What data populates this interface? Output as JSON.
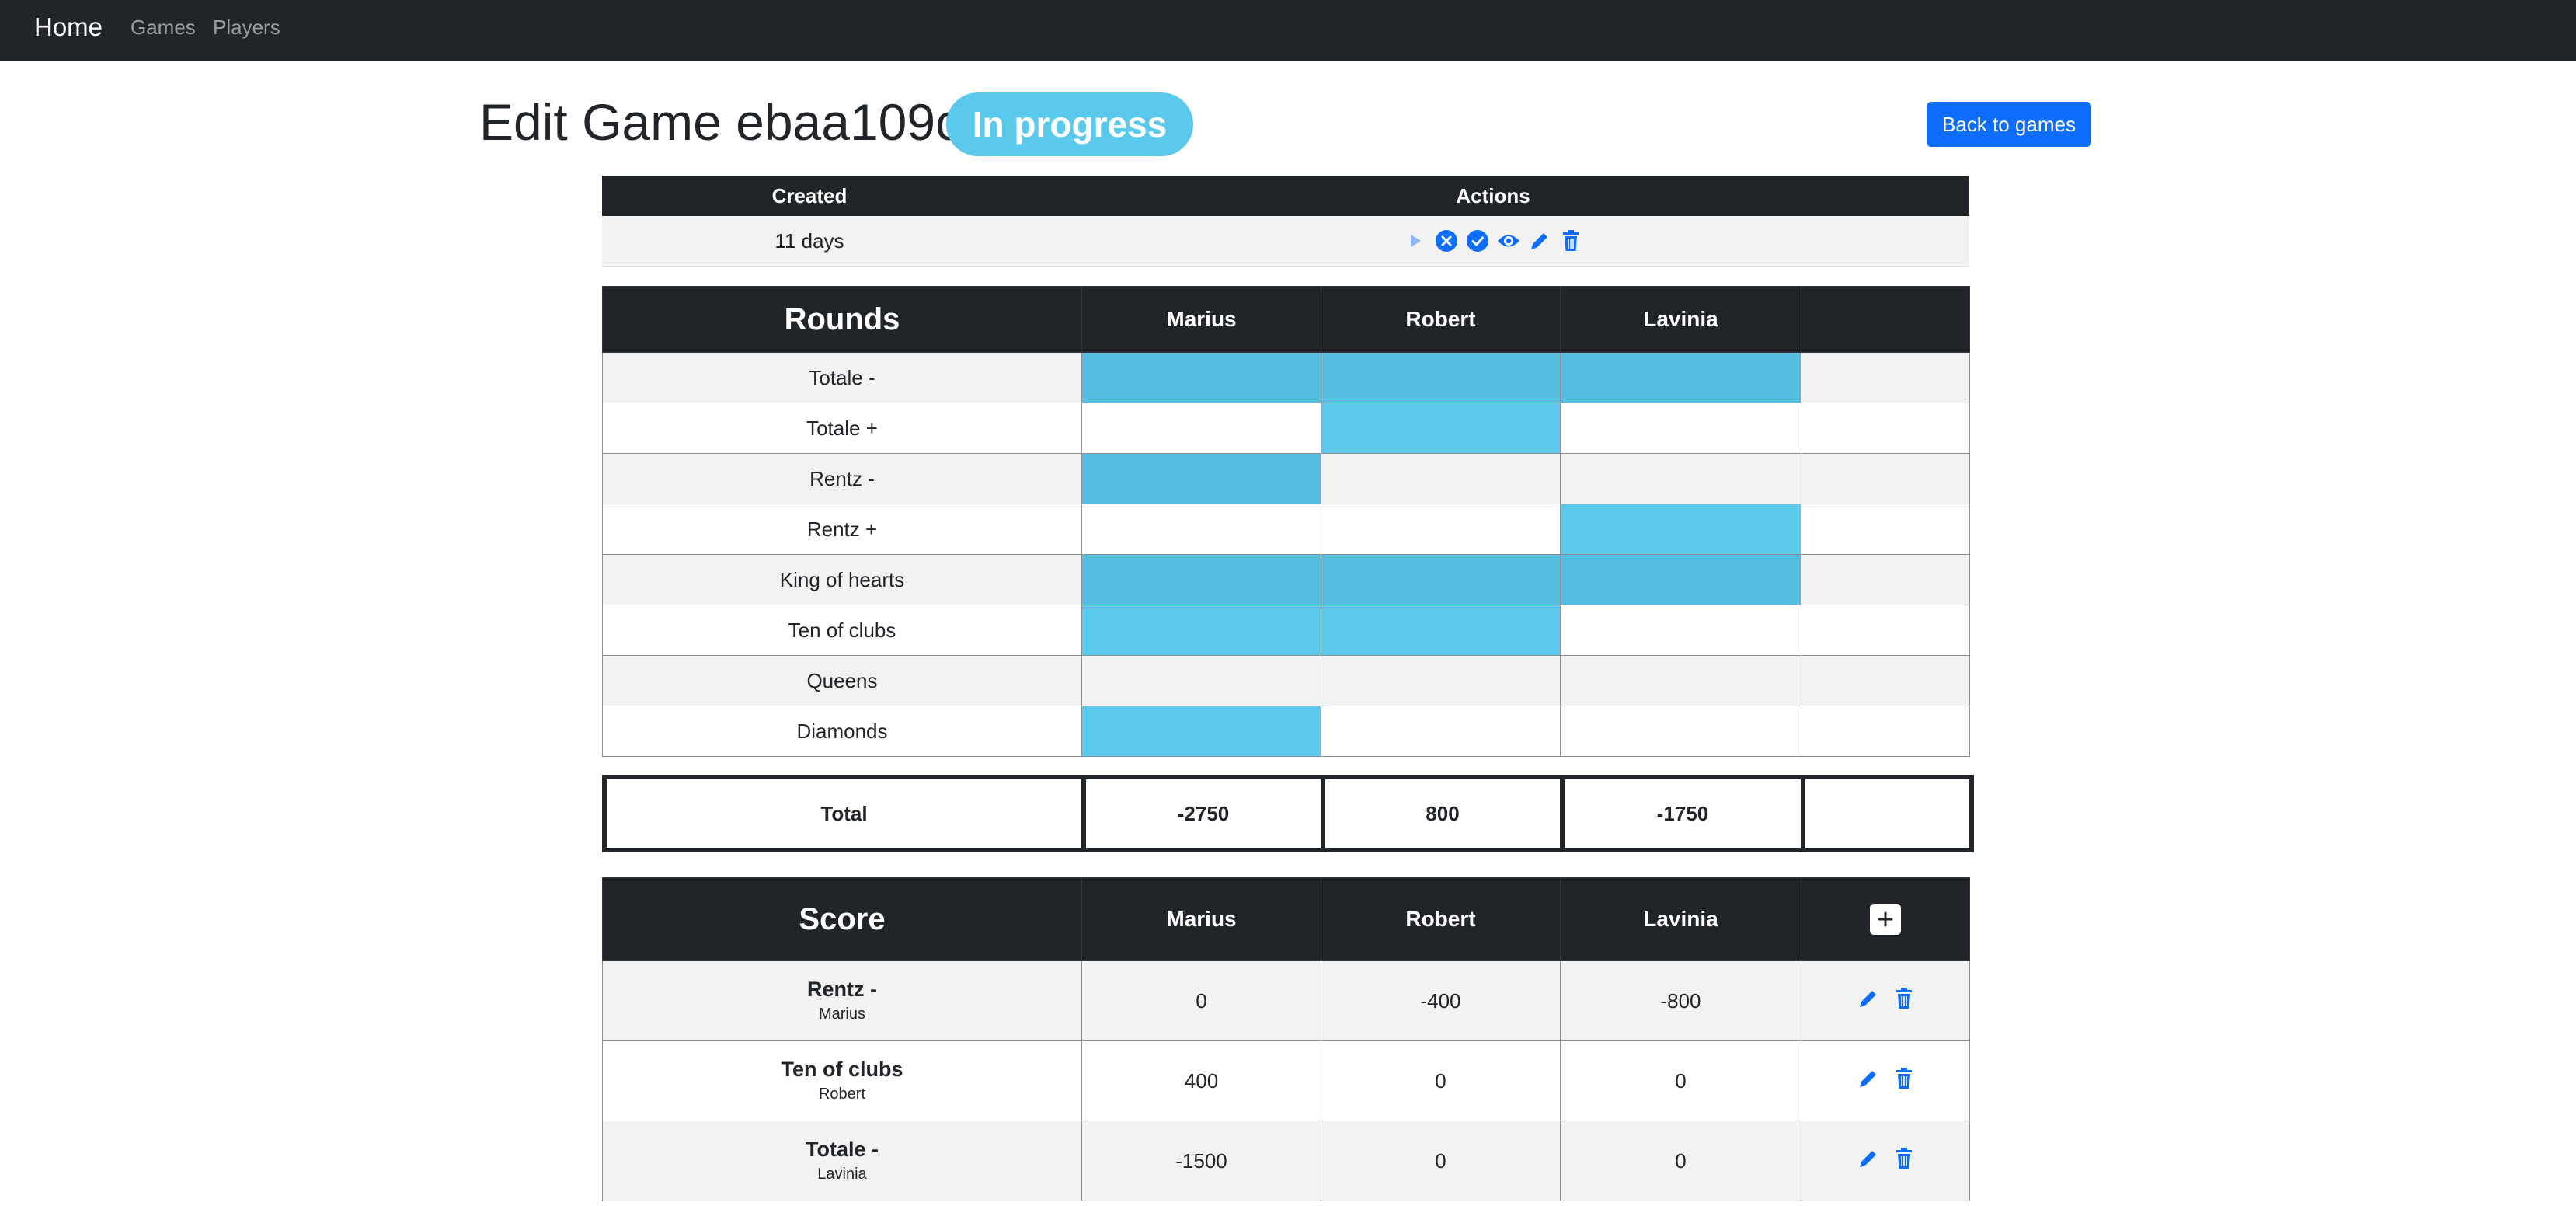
{
  "nav": {
    "brand": "Home",
    "links": [
      "Games",
      "Players"
    ]
  },
  "header": {
    "title": "Edit Game ebaa109c",
    "status": "In progress",
    "back_button": "Back to games"
  },
  "info": {
    "headers": [
      "Created",
      "Actions"
    ],
    "created": "11 days",
    "actions": [
      "play-icon",
      "cancel-circle-icon",
      "check-circle-icon",
      "eye-icon",
      "pencil-icon",
      "trash-icon"
    ]
  },
  "rounds_table": {
    "title": "Rounds",
    "players": [
      "Marius",
      "Robert",
      "Lavinia"
    ],
    "rows": [
      {
        "name": "Totale -",
        "played": [
          true,
          true,
          true
        ]
      },
      {
        "name": "Totale +",
        "played": [
          false,
          true,
          false
        ]
      },
      {
        "name": "Rentz -",
        "played": [
          true,
          false,
          false
        ]
      },
      {
        "name": "Rentz +",
        "played": [
          false,
          false,
          true
        ]
      },
      {
        "name": "King of hearts",
        "played": [
          true,
          true,
          true
        ]
      },
      {
        "name": "Ten of clubs",
        "played": [
          true,
          true,
          false
        ]
      },
      {
        "name": "Queens",
        "played": [
          false,
          false,
          false
        ]
      },
      {
        "name": "Diamonds",
        "played": [
          true,
          false,
          false
        ]
      }
    ]
  },
  "total": {
    "label": "Total",
    "values": [
      "-2750",
      "800",
      "-1750"
    ]
  },
  "score_table": {
    "title": "Score",
    "players": [
      "Marius",
      "Robert",
      "Lavinia"
    ],
    "add_icon": "plus-icon",
    "rows": [
      {
        "round": "Rentz -",
        "player": "Marius",
        "scores": [
          "0",
          "-400",
          "-800"
        ]
      },
      {
        "round": "Ten of clubs",
        "player": "Robert",
        "scores": [
          "400",
          "0",
          "0"
        ]
      },
      {
        "round": "Totale -",
        "player": "Lavinia",
        "scores": [
          "-1500",
          "0",
          "0"
        ]
      }
    ]
  },
  "colors": {
    "navbar": "#212529",
    "badge": "#5bc9eb",
    "primary": "#0d6efd",
    "selected_cell": "#5bc9eb"
  }
}
